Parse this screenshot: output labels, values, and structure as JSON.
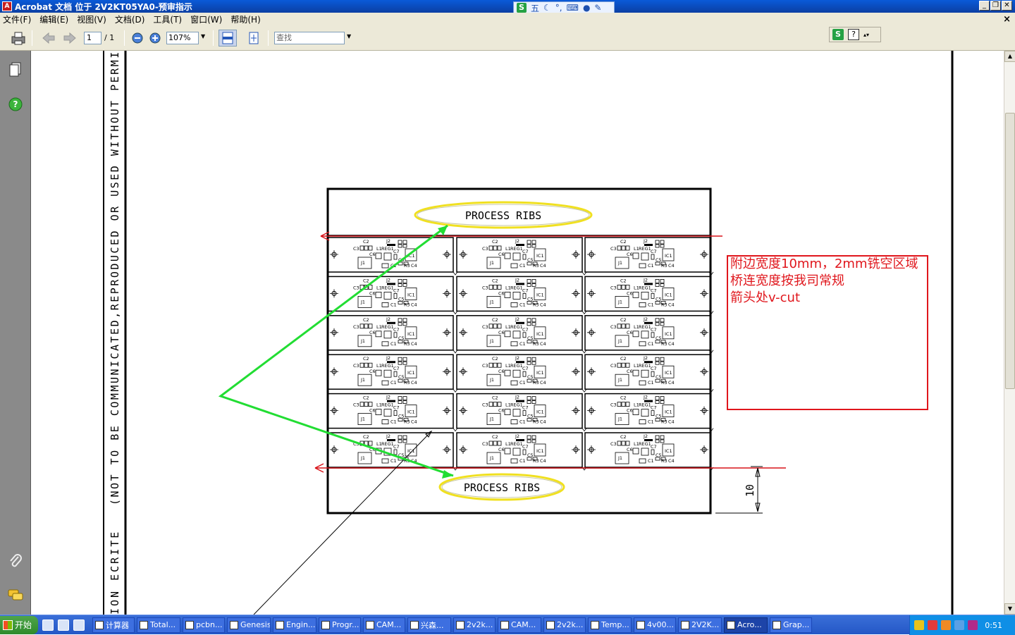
{
  "window": {
    "title": "Acrobat 文档 位于 2V2KT05YA0-预审指示",
    "app_icon": "A"
  },
  "ime": {
    "logo": "S",
    "mode": "五"
  },
  "menu": {
    "items": [
      "文件(F)",
      "编辑(E)",
      "视图(V)",
      "文档(D)",
      "工具(T)",
      "窗口(W)",
      "帮助(H)"
    ]
  },
  "toolbar": {
    "page_current": "1",
    "page_total": "/ 1",
    "zoom": "107%",
    "search_placeholder": "查找"
  },
  "drawing": {
    "side_text_top": "(NOT TO BE COMMUNICATED,REPRODUCED OR USED WITHOUT PERMISSION IN",
    "side_text_bottom": "ION ECRITE",
    "rib_label_top": "PROCESS RIBS",
    "rib_label_bottom": "PROCESS RIBS",
    "dimension_label": "10",
    "board_labels": {
      "c2": "C2",
      "c3": "C3",
      "c6": "C6",
      "c7": "C7",
      "l1": "L1",
      "reg1": "REG1",
      "j2": "J2",
      "j1": "J1",
      "ic1": "IC1",
      "c5": "C5",
      "c1": "C1",
      "r3": "R3",
      "c4": "C4"
    }
  },
  "annotation": {
    "line1": "附边宽度10mm，2mm铣空区域",
    "line2": "桥连宽度按我司常规",
    "line3": "箭头处v-cut",
    "color": "#e0161c"
  },
  "colors": {
    "arrow_green": "#22dd33",
    "ellipse_yellow": "#f0e020",
    "vcut_red": "#d8141a"
  },
  "taskbar": {
    "start_label": "开始",
    "items": [
      "计算器",
      "Total...",
      "pcbn...",
      "Genesis",
      "Engin...",
      "Progr...",
      "CAM...",
      "兴森...",
      "2v2k...",
      "CAM...",
      "2v2k...",
      "Temp...",
      "4v00...",
      "2V2K...",
      "Acro...",
      "Grap..."
    ],
    "active_index": 14,
    "clock": "0:51"
  }
}
